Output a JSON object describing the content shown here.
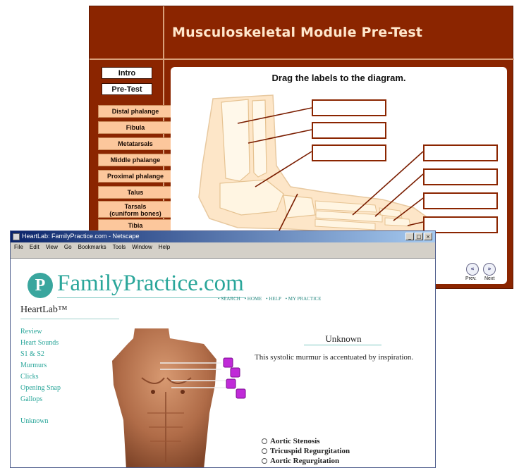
{
  "musculoskeletal": {
    "title": "Musculoskeletal Module Pre-Test",
    "nav": [
      "Intro",
      "Pre-Test"
    ],
    "labels": [
      "Distal phalange",
      "Fibula",
      "Metatarsals",
      "Middle phalange",
      "Proximal phalange",
      "Talus",
      "Tarsals\n(cuniform bones)",
      "Tibia"
    ],
    "instruction": "Drag the labels to the diagram.",
    "prev_label": "Prev.",
    "next_label": "Next"
  },
  "browser": {
    "window_title": "HeartLab: FamilyPractice.com - Netscape",
    "menu": [
      "File",
      "Edit",
      "View",
      "Go",
      "Bookmarks",
      "Tools",
      "Window",
      "Help"
    ],
    "site": {
      "logo_letter": "P",
      "brand": "FamilyPractice.com",
      "top_nav": [
        "• SEARCH",
        "• HOME",
        "• HELP",
        "• MY PRACTICE"
      ],
      "section_title": "HeartLab™",
      "side_links": [
        "Review",
        "Heart Sounds",
        "S1 & S2",
        "Murmurs",
        "Clicks",
        "Opening Snap",
        "Gallops",
        "Unknown"
      ],
      "panel_title": "Unknown",
      "description": "This systolic murmur is accentuated by inspiration.",
      "options": [
        "Aortic Stenosis",
        "Tricuspid Regurgitation",
        "Aortic Regurgitation"
      ]
    }
  },
  "colors": {
    "module_bg": "#8b2500",
    "label_bg": "#fcc79c",
    "brand_teal": "#2aa69a",
    "marker_purple": "#c02ad8"
  }
}
